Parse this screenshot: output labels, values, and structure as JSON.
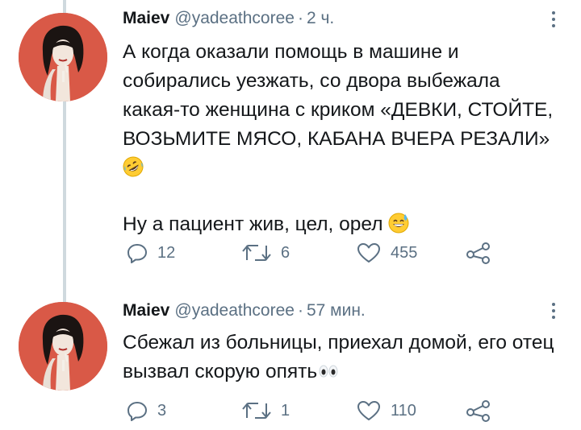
{
  "tweets": [
    {
      "author": {
        "name": "Maiev",
        "handle": "@yadeathcoree",
        "separator": "·",
        "time": "2 ч."
      },
      "paragraphs": [
        "А когда оказали помощь в машине и собирались уезжать, со двора выбежала какая-то женщина с криком «ДЕВКИ, СТОЙТЕ, ВОЗЬМИТЕ МЯСО, КАБАНА ВЧЕРА РЕЗАЛИ»",
        "Ну а пациент жив, цел, орел"
      ],
      "emojis": [
        "rolling-on-floor-laughing-emoji",
        "grinning-sweat-emoji"
      ],
      "stats": {
        "replies": "12",
        "retweets": "6",
        "likes": "455"
      }
    },
    {
      "author": {
        "name": "Maiev",
        "handle": "@yadeathcoree",
        "separator": "·",
        "time": "57 мин."
      },
      "paragraphs": [
        "Сбежал из больницы, приехал домой, его отец вызвал скорую опять"
      ],
      "emojis": [
        "eyes-emoji"
      ],
      "stats": {
        "replies": "3",
        "retweets": "1",
        "likes": "110"
      }
    }
  ],
  "icons": {
    "reply": "reply-icon",
    "retweet": "retweet-icon",
    "like": "like-icon",
    "share": "share-icon",
    "more": "more-icon"
  },
  "colors": {
    "text": "#14171a",
    "secondary": "#5b7083",
    "thread_line": "#cfd9de",
    "avatar_bg": "#d95947"
  }
}
